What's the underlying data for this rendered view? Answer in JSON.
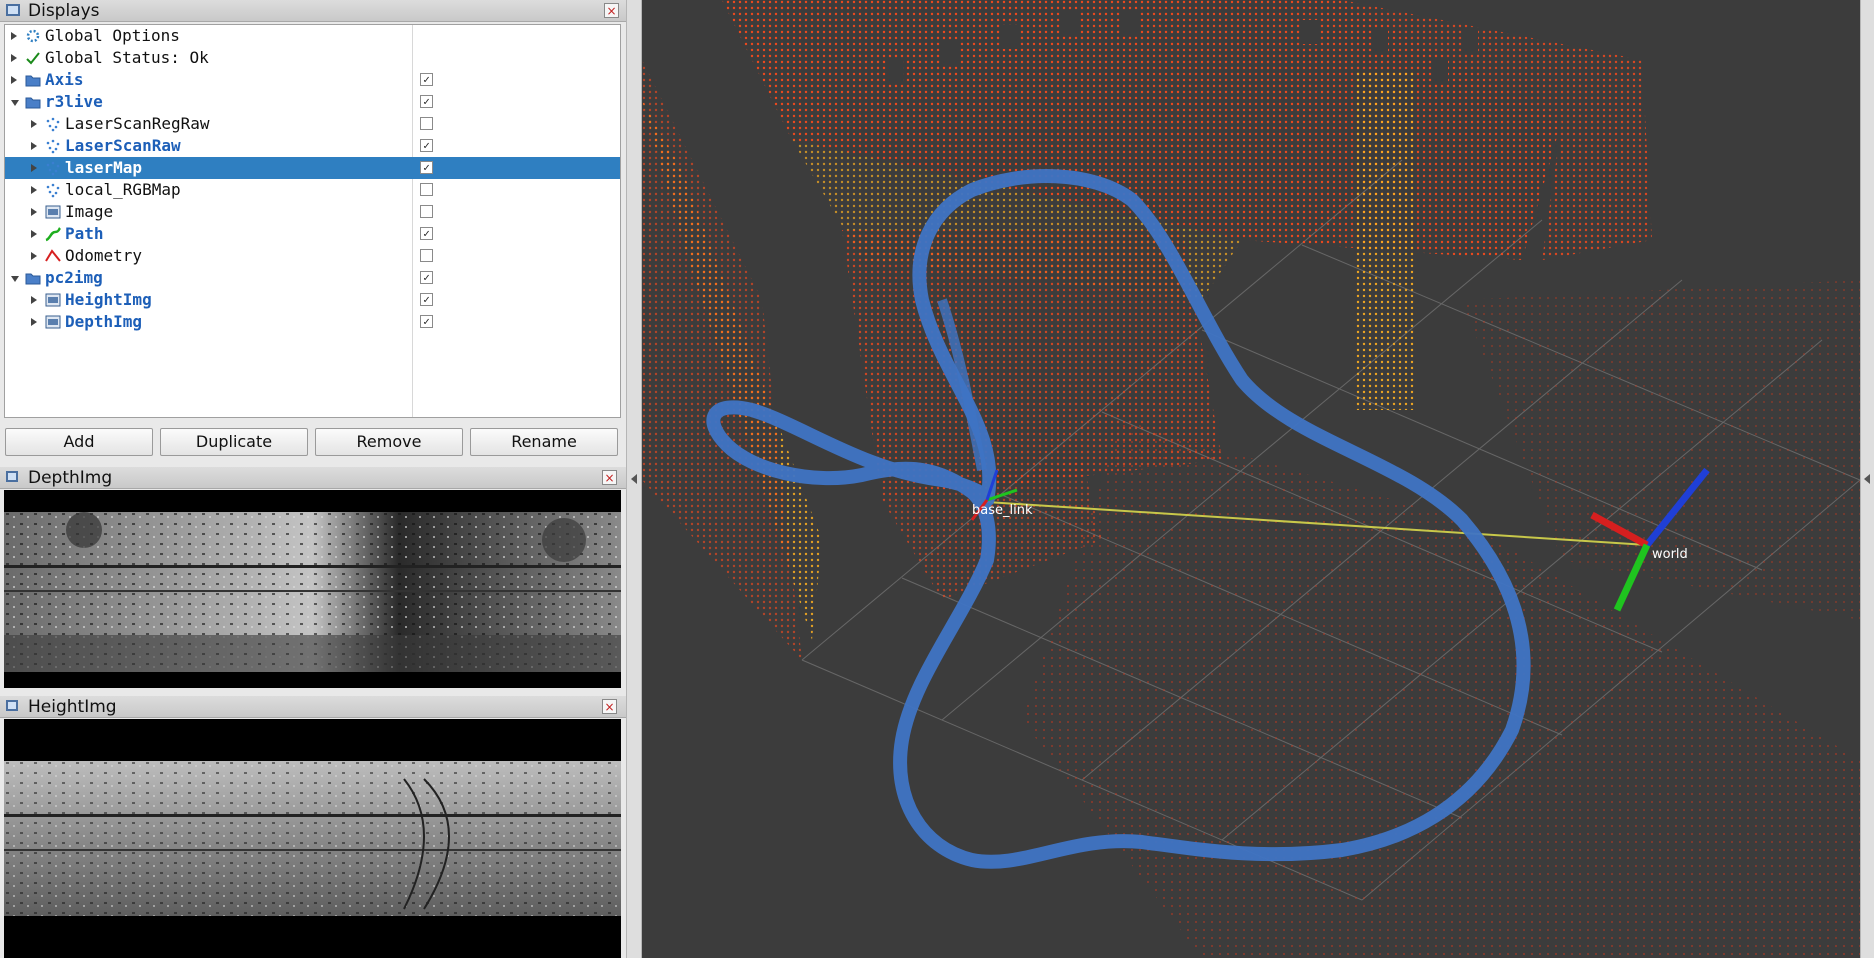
{
  "displays_panel": {
    "title": "Displays",
    "close": "×",
    "tree": [
      {
        "label": "Global Options",
        "icon": "gear-icon",
        "highlight": false,
        "checked": null
      },
      {
        "label": "Global Status: Ok",
        "icon": "checkmark-icon",
        "highlight": false,
        "checked": null
      },
      {
        "label": "Axis",
        "icon": "folder-icon",
        "highlight": true,
        "checked": true
      },
      {
        "label": "r3live",
        "icon": "folder-icon",
        "highlight": true,
        "checked": true
      },
      {
        "label": "LaserScanRegRaw",
        "icon": "pointcloud-icon",
        "highlight": false,
        "checked": false
      },
      {
        "label": "LaserScanRaw",
        "icon": "pointcloud-icon",
        "highlight": true,
        "checked": true
      },
      {
        "label": "laserMap",
        "icon": "pointcloud-icon",
        "highlight": true,
        "checked": true,
        "selected": true
      },
      {
        "label": "local_RGBMap",
        "icon": "pointcloud-icon",
        "highlight": false,
        "checked": false
      },
      {
        "label": "Image",
        "icon": "image-icon",
        "highlight": false,
        "checked": false
      },
      {
        "label": "Path",
        "icon": "path-icon",
        "highlight": true,
        "checked": true
      },
      {
        "label": "Odometry",
        "icon": "odometry-icon",
        "highlight": false,
        "checked": false
      },
      {
        "label": "pc2img",
        "icon": "folder-icon",
        "highlight": true,
        "checked": true
      },
      {
        "label": "HeightImg",
        "icon": "image-icon",
        "highlight": true,
        "checked": true
      },
      {
        "label": "DepthImg",
        "icon": "image-icon",
        "highlight": true,
        "checked": true
      }
    ],
    "buttons": {
      "add": "Add",
      "duplicate": "Duplicate",
      "remove": "Remove",
      "rename": "Rename"
    }
  },
  "depth_panel": {
    "title": "DepthImg",
    "close": "×"
  },
  "height_panel": {
    "title": "HeightImg",
    "close": "×"
  },
  "viewport": {
    "frame_labels": {
      "left": "base_link",
      "right": "world"
    }
  },
  "colors": {
    "selection": "#2f7fc1",
    "highlight_text": "#1d5fb8",
    "path": "#3f74c4",
    "viewport_bg": "#3c3c3c"
  }
}
